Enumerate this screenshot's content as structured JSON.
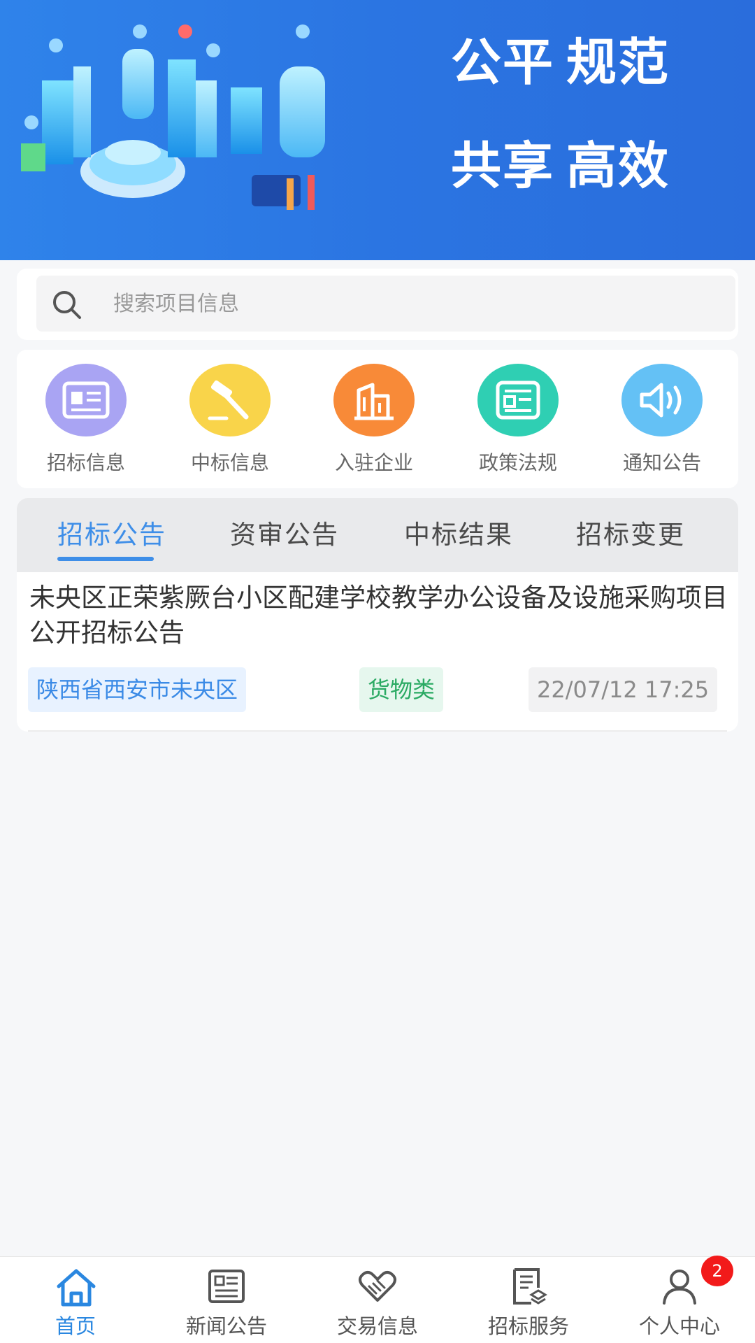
{
  "banner": {
    "slogan": [
      "公平",
      "规范",
      "共享",
      "高效"
    ]
  },
  "search": {
    "placeholder": "搜索项目信息",
    "value": ""
  },
  "quick_links": [
    {
      "label": "招标信息",
      "icon": "newspaper-icon",
      "color": "#a9a4f3"
    },
    {
      "label": "中标信息",
      "icon": "gavel-icon",
      "color": "#f9d44a"
    },
    {
      "label": "入驻企业",
      "icon": "building-icon",
      "color": "#f88a38"
    },
    {
      "label": "政策法规",
      "icon": "document-icon",
      "color": "#2fcfb3"
    },
    {
      "label": "通知公告",
      "icon": "speaker-icon",
      "color": "#64c1f5"
    }
  ],
  "tabs": [
    "招标公告",
    "资审公告",
    "中标结果",
    "招标变更"
  ],
  "active_tab": 0,
  "listing": {
    "title": "未央区正荣紫厥台小区配建学校教学办公设备及设施采购项目公开招标公告",
    "region": "陕西省西安市未央区",
    "category": "货物类",
    "date": "22/07/12 17:25"
  },
  "bottom_nav": [
    {
      "label": "首页",
      "icon": "home-icon"
    },
    {
      "label": "新闻公告",
      "icon": "news-icon"
    },
    {
      "label": "交易信息",
      "icon": "handshake-icon"
    },
    {
      "label": "招标服务",
      "icon": "service-doc-icon"
    },
    {
      "label": "个人中心",
      "icon": "user-icon"
    }
  ],
  "notification_badge": "2",
  "colors": {
    "primary": "#3e8ee8",
    "banner": "#2f83ea",
    "badge": "#f21a1a"
  }
}
